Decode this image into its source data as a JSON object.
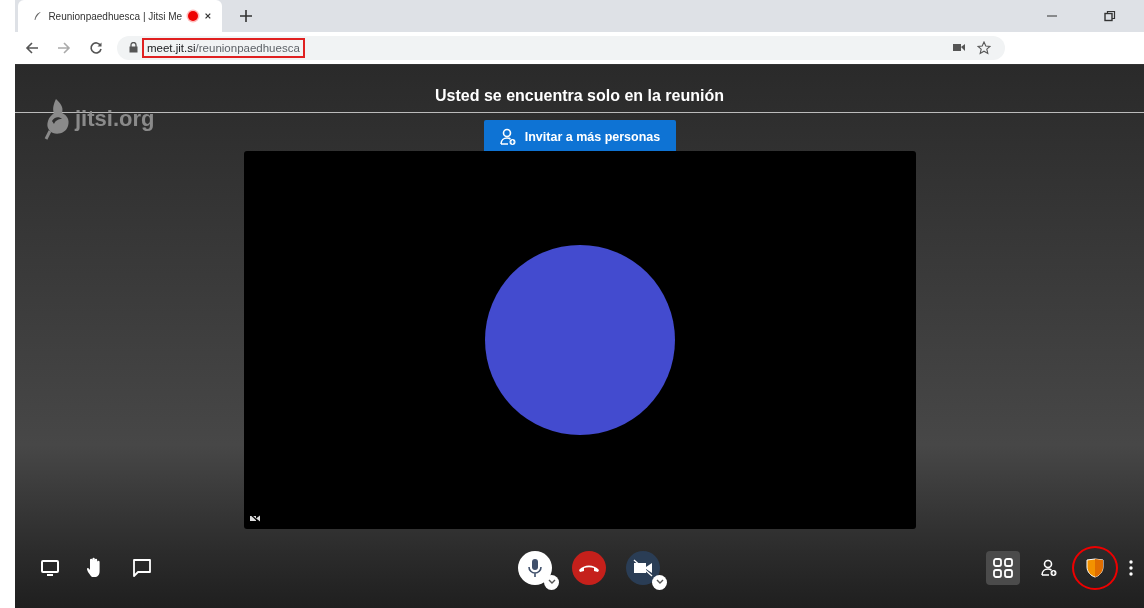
{
  "browser": {
    "tab_title": "Reunionpaedhuesca | Jitsi Me",
    "recording": true,
    "url_host": "meet.jit.si",
    "url_path": "/reunionpaedhuesca"
  },
  "meeting": {
    "logo": "jitsi.org",
    "notice": "Usted se encuentra solo en la reunión",
    "invite_button": "Invitar a más personas"
  },
  "toolbar": {
    "left": [
      {
        "kind": "screen"
      },
      {
        "kind": "hand"
      },
      {
        "kind": "chat"
      }
    ],
    "center": [
      {
        "kind": "mic",
        "muted": false
      },
      {
        "kind": "hangup"
      },
      {
        "kind": "camera",
        "muted": true
      }
    ],
    "right": [
      {
        "kind": "tiles",
        "selected": true
      },
      {
        "kind": "invite",
        "selected": false
      },
      {
        "kind": "security",
        "selected": false
      },
      {
        "kind": "more",
        "selected": false
      }
    ]
  }
}
